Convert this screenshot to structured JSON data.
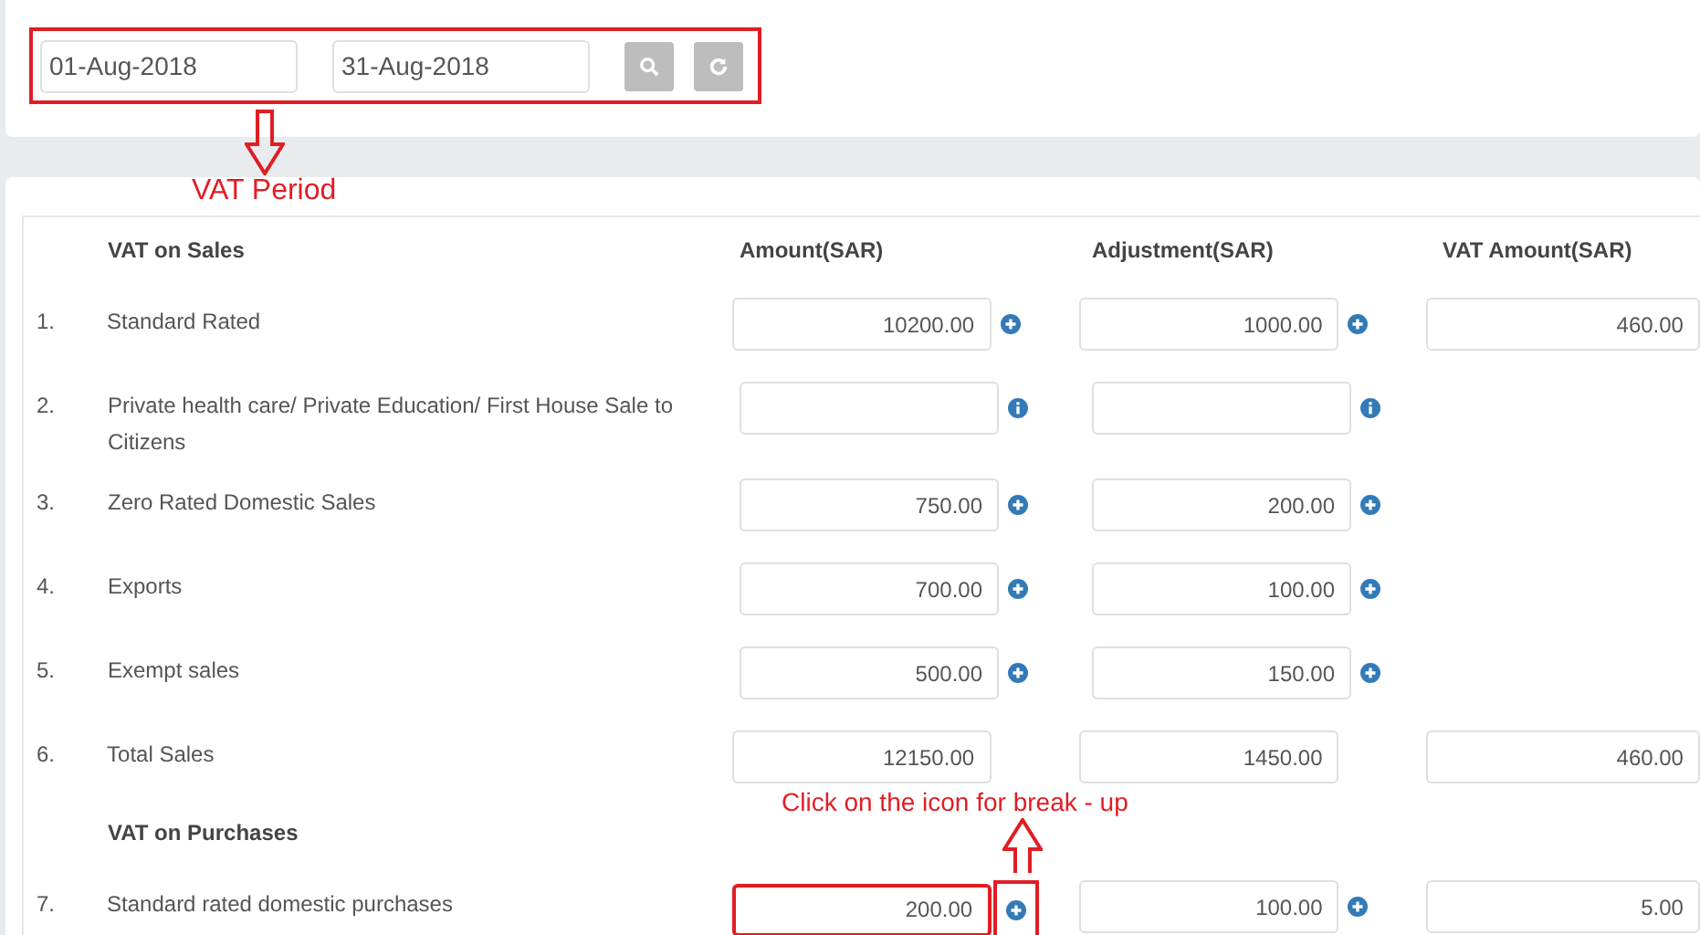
{
  "filters": {
    "from_date": "01-Aug-2018",
    "to_date": "31-Aug-2018",
    "highlighted": true
  },
  "table": {
    "columns": [
      "VAT on Sales",
      "Amount(SAR)",
      "Adjustment(SAR)",
      "VAT Amount(SAR)"
    ],
    "rows": [
      {
        "kind": "item",
        "number": "1.",
        "label": "Standard Rated",
        "amount": {
          "value": "10200.00",
          "kind": "breakup"
        },
        "adjustment": {
          "value": "1000.00",
          "kind": "breakup"
        },
        "vat": {
          "value": "460.00"
        }
      },
      {
        "kind": "item",
        "number": "2.",
        "label": "Private health care/ Private Education/ First House Sale to Citizens",
        "amount": {
          "kind": "info"
        },
        "adjustment": {
          "kind": "info"
        }
      },
      {
        "kind": "item",
        "number": "3.",
        "label": "Zero Rated Domestic Sales",
        "amount": {
          "value": "750.00",
          "kind": "breakup"
        },
        "adjustment": {
          "value": "200.00",
          "kind": "breakup"
        }
      },
      {
        "kind": "item",
        "number": "4.",
        "label": "Exports",
        "amount": {
          "value": "700.00",
          "kind": "breakup"
        },
        "adjustment": {
          "value": "100.00",
          "kind": "breakup"
        }
      },
      {
        "kind": "item",
        "number": "5.",
        "label": "Exempt sales",
        "amount": {
          "value": "500.00",
          "kind": "breakup"
        },
        "adjustment": {
          "value": "150.00",
          "kind": "breakup"
        }
      },
      {
        "kind": "item",
        "number": "6.",
        "label": "Total Sales",
        "amount": {
          "value": "12150.00"
        },
        "adjustment": {
          "value": "1450.00"
        },
        "vat": {
          "value": "460.00"
        }
      },
      {
        "kind": "section",
        "label": "VAT on Purchases"
      },
      {
        "kind": "item",
        "number": "7.",
        "label": "Standard rated domestic purchases",
        "amount": {
          "value": "200.00",
          "kind": "breakup",
          "highlighted": true
        },
        "adjustment": {
          "value": "100.00",
          "kind": "breakup"
        },
        "vat": {
          "value": "5.00"
        }
      }
    ]
  },
  "annotations": [
    {
      "kind": "down",
      "text": "VAT Period"
    },
    {
      "kind": "up",
      "text": "Click on the icon for break - up"
    }
  ]
}
